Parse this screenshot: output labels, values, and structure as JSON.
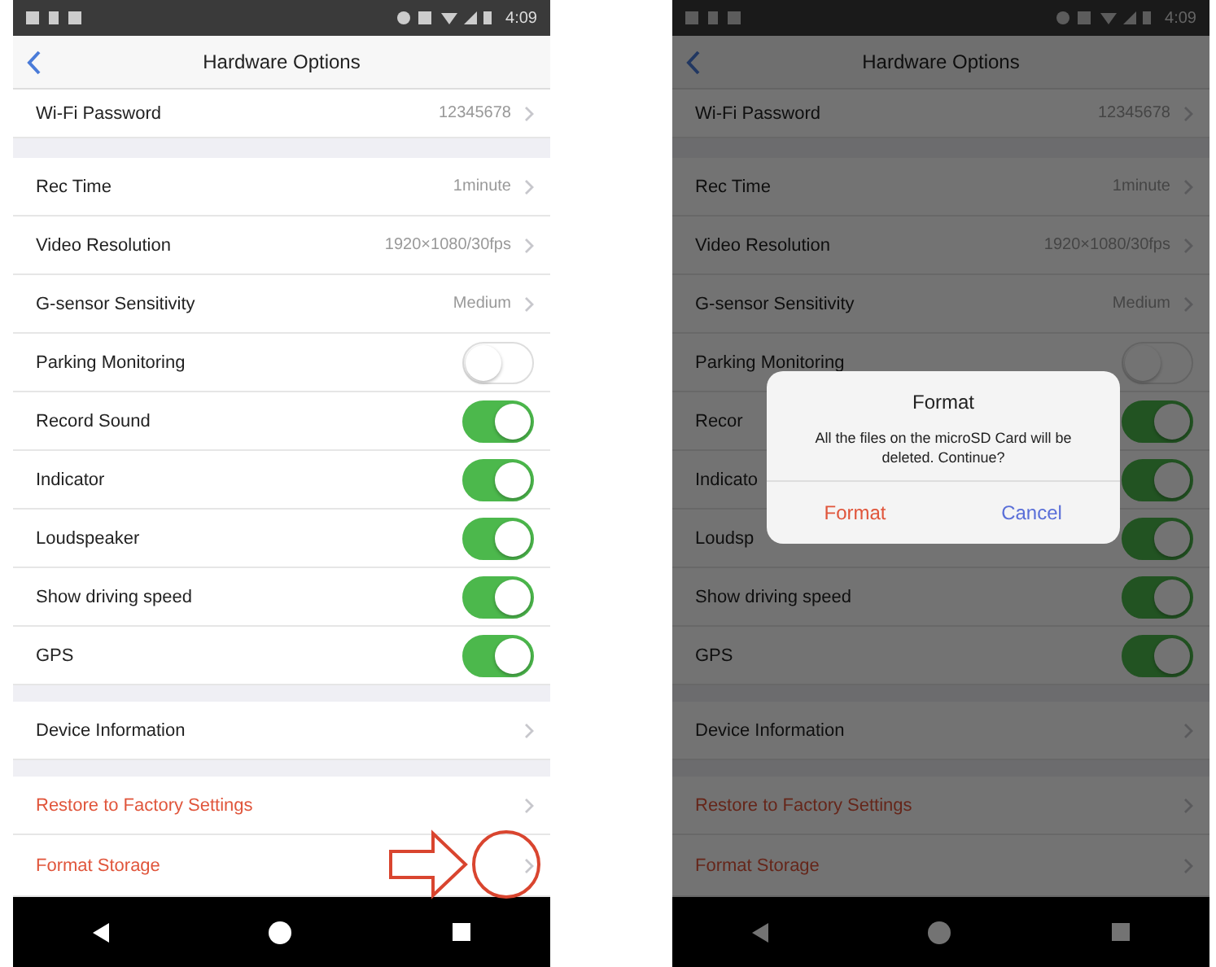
{
  "screens": [
    {
      "status_time": "4:09",
      "title": "Hardware Options",
      "annotated": true,
      "groups": [
        [
          {
            "kind": "value",
            "label": "Wi-Fi Password",
            "value": "12345678"
          }
        ],
        [
          {
            "kind": "value",
            "label": "Rec Time",
            "value": "1minute"
          },
          {
            "kind": "value",
            "label": "Video Resolution",
            "value": "1920×1080/30fps"
          },
          {
            "kind": "value",
            "label": "G-sensor Sensitivity",
            "value": "Medium"
          },
          {
            "kind": "toggle",
            "label": "Parking Monitoring",
            "on": false
          },
          {
            "kind": "toggle",
            "label": "Record Sound",
            "on": true
          },
          {
            "kind": "toggle",
            "label": "Indicator",
            "on": true
          },
          {
            "kind": "toggle",
            "label": "Loudspeaker",
            "on": true
          },
          {
            "kind": "toggle",
            "label": "Show driving speed",
            "on": true
          },
          {
            "kind": "toggle",
            "label": "GPS",
            "on": true
          }
        ],
        [
          {
            "kind": "link",
            "label": "Device Information"
          }
        ],
        [
          {
            "kind": "danger",
            "label": "Restore to Factory Settings"
          },
          {
            "kind": "danger",
            "label": "Format Storage"
          }
        ]
      ]
    },
    {
      "status_time": "4:09",
      "title": "Hardware Options",
      "annotated": false,
      "groups": [
        [
          {
            "kind": "value",
            "label": "Wi-Fi Password",
            "value": "12345678"
          }
        ],
        [
          {
            "kind": "value",
            "label": "Rec Time",
            "value": "1minute"
          },
          {
            "kind": "value",
            "label": "Video Resolution",
            "value": "1920×1080/30fps"
          },
          {
            "kind": "value",
            "label": "G-sensor Sensitivity",
            "value": "Medium"
          },
          {
            "kind": "toggle",
            "label": "Parking Monitoring",
            "on": false
          },
          {
            "kind": "toggle",
            "label": "Recor",
            "on": true
          },
          {
            "kind": "toggle",
            "label": "Indicato",
            "on": true
          },
          {
            "kind": "toggle",
            "label": "Loudsp",
            "on": true
          },
          {
            "kind": "toggle",
            "label": "Show driving speed",
            "on": true
          },
          {
            "kind": "toggle",
            "label": "GPS",
            "on": true
          }
        ],
        [
          {
            "kind": "link",
            "label": "Device Information"
          }
        ],
        [
          {
            "kind": "danger",
            "label": "Restore to Factory Settings"
          },
          {
            "kind": "danger",
            "label": "Format Storage"
          }
        ]
      ],
      "dialog": {
        "title": "Format",
        "message": "All the files on the microSD Card will be deleted. Continue?",
        "buttons": [
          {
            "label": "Format",
            "kind": "destructive"
          },
          {
            "label": "Cancel",
            "kind": "cancel"
          }
        ]
      }
    }
  ]
}
